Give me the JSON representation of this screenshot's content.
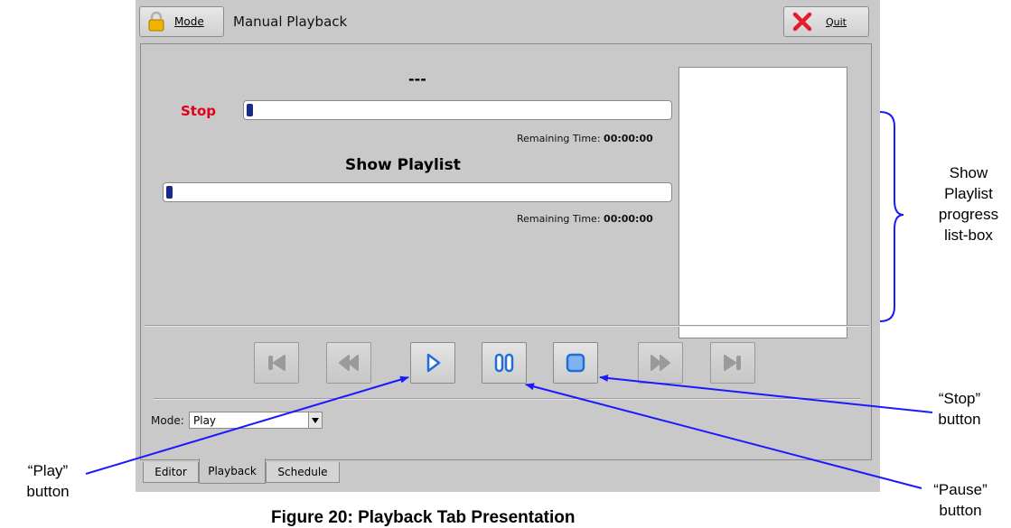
{
  "window": {
    "mode_button": "Mode",
    "title": "Manual Playback",
    "quit_button": "Quit"
  },
  "main": {
    "event_name": "---",
    "stop_label": "Stop",
    "event_remaining_label": "Remaining Time:",
    "event_remaining_value": "00:00:00",
    "show_playlist_title": "Show Playlist",
    "playlist_remaining_label": "Remaining Time:",
    "playlist_remaining_value": "00:00:00",
    "event_progress": 0,
    "playlist_progress": 0
  },
  "transport": {
    "buttons": [
      "skip-to-start",
      "rewind",
      "play",
      "pause",
      "stop",
      "fast-forward",
      "skip-to-end"
    ],
    "icon_colors": {
      "disabled": "#9a9a9a",
      "active": "#1f6fd6"
    }
  },
  "mode_select": {
    "label": "Mode:",
    "value": "Play"
  },
  "tabs": [
    {
      "label": "Editor"
    },
    {
      "label": "Playback",
      "selected": true
    },
    {
      "label": "Schedule"
    }
  ],
  "annotations": {
    "listbox_note": [
      "Show",
      "Playlist",
      "progress",
      "list-box"
    ],
    "stop_note": [
      "“Stop”",
      "button"
    ],
    "play_note": [
      "“Play”",
      "button"
    ],
    "pause_note": [
      "“Pause”",
      "button"
    ],
    "arrow_color": "#1a1aff"
  },
  "caption": "Figure 20: Playback Tab Presentation"
}
